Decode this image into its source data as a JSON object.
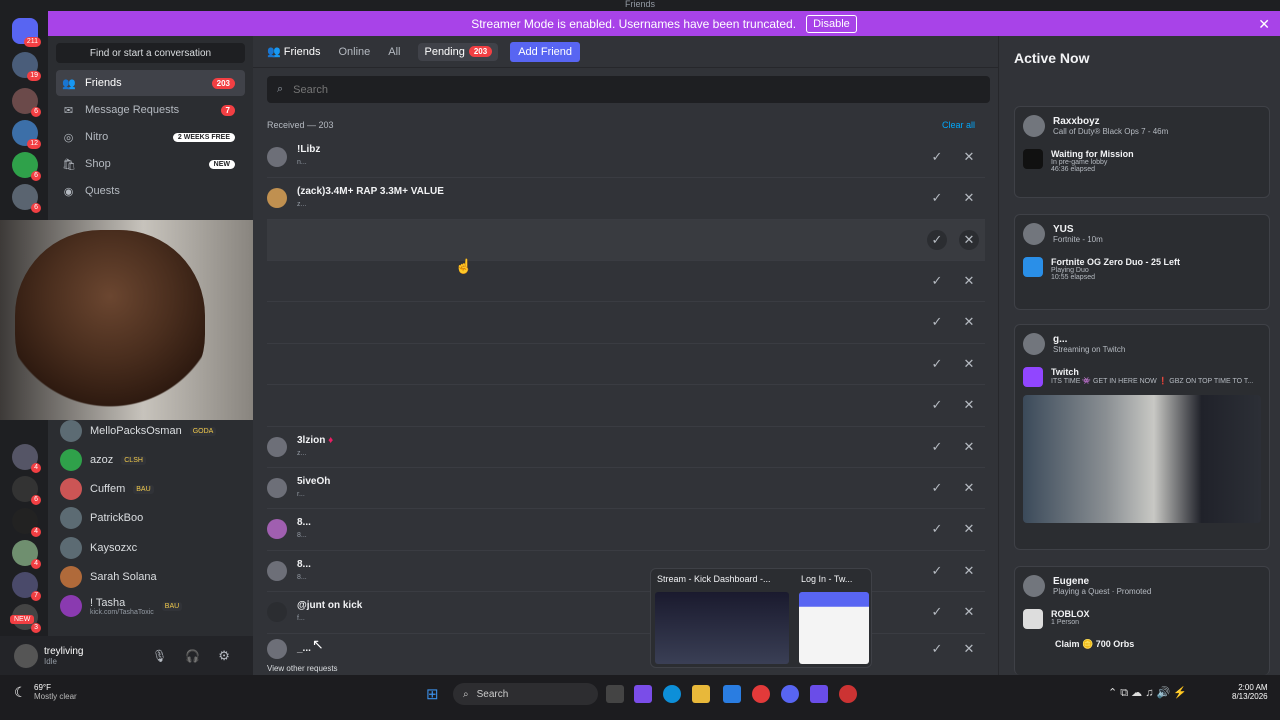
{
  "window": {
    "title": "Friends"
  },
  "banner": {
    "text": "Streamer Mode is enabled. Usernames have been truncated.",
    "disable_label": "Disable"
  },
  "servers": {
    "home_badge": "211",
    "badges": [
      "19",
      "6",
      "12",
      "6",
      "6",
      "6",
      "4",
      "6",
      "4",
      "4",
      "7",
      "3"
    ],
    "new_label": "NEW"
  },
  "sidebar": {
    "search_label": "Find or start a conversation",
    "items": [
      {
        "label": "Friends",
        "badge": "203"
      },
      {
        "label": "Message Requests",
        "badge": "7"
      },
      {
        "label": "Nitro",
        "badge": "2 WEEKS FREE"
      },
      {
        "label": "Shop",
        "badge": "NEW"
      },
      {
        "label": "Quests",
        "badge": ""
      }
    ],
    "dms": [
      {
        "name": "MelloPacksOsman",
        "tag": "GODA"
      },
      {
        "name": "azoz",
        "tag": "CLSH"
      },
      {
        "name": "Cuffem",
        "tag": "BAU"
      },
      {
        "name": "PatrickBoo",
        "tag": ""
      },
      {
        "name": "Kaysozxc",
        "tag": ""
      },
      {
        "name": "Sarah Solana",
        "tag": ""
      },
      {
        "name": "! Tasha",
        "tag": "BAU",
        "sub": "kick.com/TashaToxic"
      }
    ]
  },
  "user": {
    "name": "treyliving",
    "status": "Idle"
  },
  "tabs": {
    "friends": "Friends",
    "online": "Online",
    "all": "All",
    "pending": "Pending",
    "pending_count": "203",
    "add": "Add Friend"
  },
  "search": {
    "placeholder": "Search"
  },
  "received": {
    "header": "Received — 203",
    "clear_all": "Clear all",
    "view_other": "View other requests"
  },
  "requests": [
    {
      "name": "!Libz",
      "sub": "n..."
    },
    {
      "name": "(zack)3.4M+ RAP 3.3M+ VALUE",
      "sub": "z..."
    },
    {
      "name": "",
      "sub": ""
    },
    {
      "name": "",
      "sub": ""
    },
    {
      "name": "",
      "sub": ""
    },
    {
      "name": "",
      "sub": ""
    },
    {
      "name": "",
      "sub": ""
    },
    {
      "name": "3lzion",
      "sub": "z..."
    },
    {
      "name": "5iveOh",
      "sub": "r..."
    },
    {
      "name": "8...",
      "sub": "8..."
    },
    {
      "name": "8...",
      "sub": "8..."
    },
    {
      "name": "@junt on kick",
      "sub": "f..."
    },
    {
      "name": "_...",
      "sub": ""
    }
  ],
  "active_now": {
    "title": "Active Now",
    "cards": [
      {
        "name": "Raxxboyz",
        "line": "Call of Duty® Black Ops 7 - 46m",
        "body_title": "Waiting for Mission",
        "body_sub1": "In pre-game lobby",
        "body_sub2": "46:36 elapsed"
      },
      {
        "name": "YUS",
        "line": "Fortnite - 10m",
        "body_title": "Fortnite OG Zero Duo - 25 Left",
        "body_sub1": "Playing Duo",
        "body_sub2": "10:55 elapsed"
      },
      {
        "name": "g...",
        "line": "Streaming on Twitch",
        "body_title": "Twitch",
        "body_sub1": "ITS TIME 👾 GET IN HERE NOW ❗ GBZ ON TOP TIME TO T..."
      },
      {
        "name": "Eugene",
        "line": "Playing a Quest · Promoted",
        "body_title": "ROBLOX",
        "body_sub1": "1 Person",
        "claim": "Claim 🪙 700 Orbs"
      }
    ]
  },
  "popup": {
    "left": "Stream - Kick Dashboard -...",
    "right": "Log In - Tw..."
  },
  "taskbar": {
    "weather_temp": "69°F",
    "weather_text": "Mostly clear",
    "search": "Search",
    "time": "2:00 AM",
    "date": "8/13/2026"
  }
}
